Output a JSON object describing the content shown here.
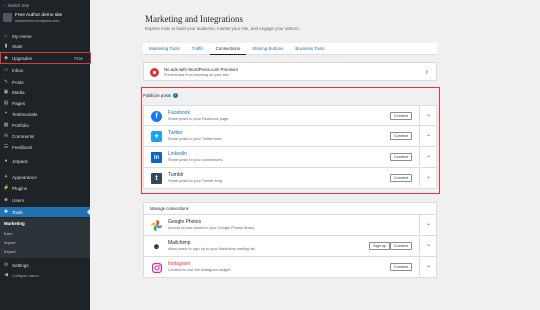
{
  "sidebar": {
    "switch_site": "Switch Site",
    "site_name": "Free Author demo site",
    "site_url": "authordemo.wordpress.com",
    "items": [
      {
        "label": "My Home",
        "icon": "home-icon"
      },
      {
        "label": "Stats",
        "icon": "stats-icon"
      },
      {
        "label": "Upgrades",
        "icon": "upgrades-icon",
        "badge": "Free"
      },
      {
        "label": "Inbox",
        "icon": "inbox-icon"
      },
      {
        "label": "Posts",
        "icon": "posts-icon"
      },
      {
        "label": "Media",
        "icon": "media-icon"
      },
      {
        "label": "Pages",
        "icon": "pages-icon"
      },
      {
        "label": "Testimonials",
        "icon": "testimonials-icon"
      },
      {
        "label": "Portfolio",
        "icon": "portfolio-icon"
      },
      {
        "label": "Comments",
        "icon": "comments-icon"
      },
      {
        "label": "Feedback",
        "icon": "feedback-icon"
      },
      {
        "label": "Jetpack",
        "icon": "jetpack-icon"
      },
      {
        "label": "Appearance",
        "icon": "appearance-icon"
      },
      {
        "label": "Plugins",
        "icon": "plugins-icon"
      },
      {
        "label": "Users",
        "icon": "users-icon"
      },
      {
        "label": "Tools",
        "icon": "tools-icon"
      }
    ],
    "submenu": [
      "Marketing",
      "Earn",
      "Import",
      "Export"
    ],
    "bottom_items": [
      {
        "label": "Settings",
        "icon": "settings-icon"
      },
      {
        "label": "Collapse menu",
        "icon": "collapse-icon"
      }
    ]
  },
  "main": {
    "title": "Marketing and Integrations",
    "subtitle": "Explore tools to build your audience, market your site, and engage your visitors.",
    "tabs": [
      "Marketing Tools",
      "Traffic",
      "Connections",
      "Sharing Buttons",
      "Business Tools"
    ],
    "selected_tab": "Connections",
    "noads": {
      "title": "No ads with WordPress.com Premium",
      "desc": "Prevent ads from showing on your site."
    },
    "publicize_heading": "Publicize posts",
    "publicize": [
      {
        "name": "Facebook",
        "desc": "Share posts to your Facebook page.",
        "button": "Connect",
        "color": "#1877f2"
      },
      {
        "name": "Twitter",
        "desc": "Share posts to your Twitter feed.",
        "button": "Connect",
        "color": "#1da1f2"
      },
      {
        "name": "LinkedIn",
        "desc": "Share posts to your connections.",
        "button": "Connect",
        "color": "#0a66c2"
      },
      {
        "name": "Tumblr",
        "desc": "Share posts to your Tumblr blog.",
        "button": "Connect",
        "color": "#36465d"
      }
    ],
    "manage_heading": "Manage connections",
    "manage": [
      {
        "name": "Google Photos",
        "desc": "Access photos stored in your Google Photos library."
      },
      {
        "name": "Mailchimp",
        "desc": "Allow users to sign up to your Mailchimp mailing list.",
        "button2": "Sign up",
        "button": "Connect"
      },
      {
        "name": "Instagram",
        "desc": "Connect to use the Instagram widget.",
        "button": "Connect"
      }
    ]
  }
}
